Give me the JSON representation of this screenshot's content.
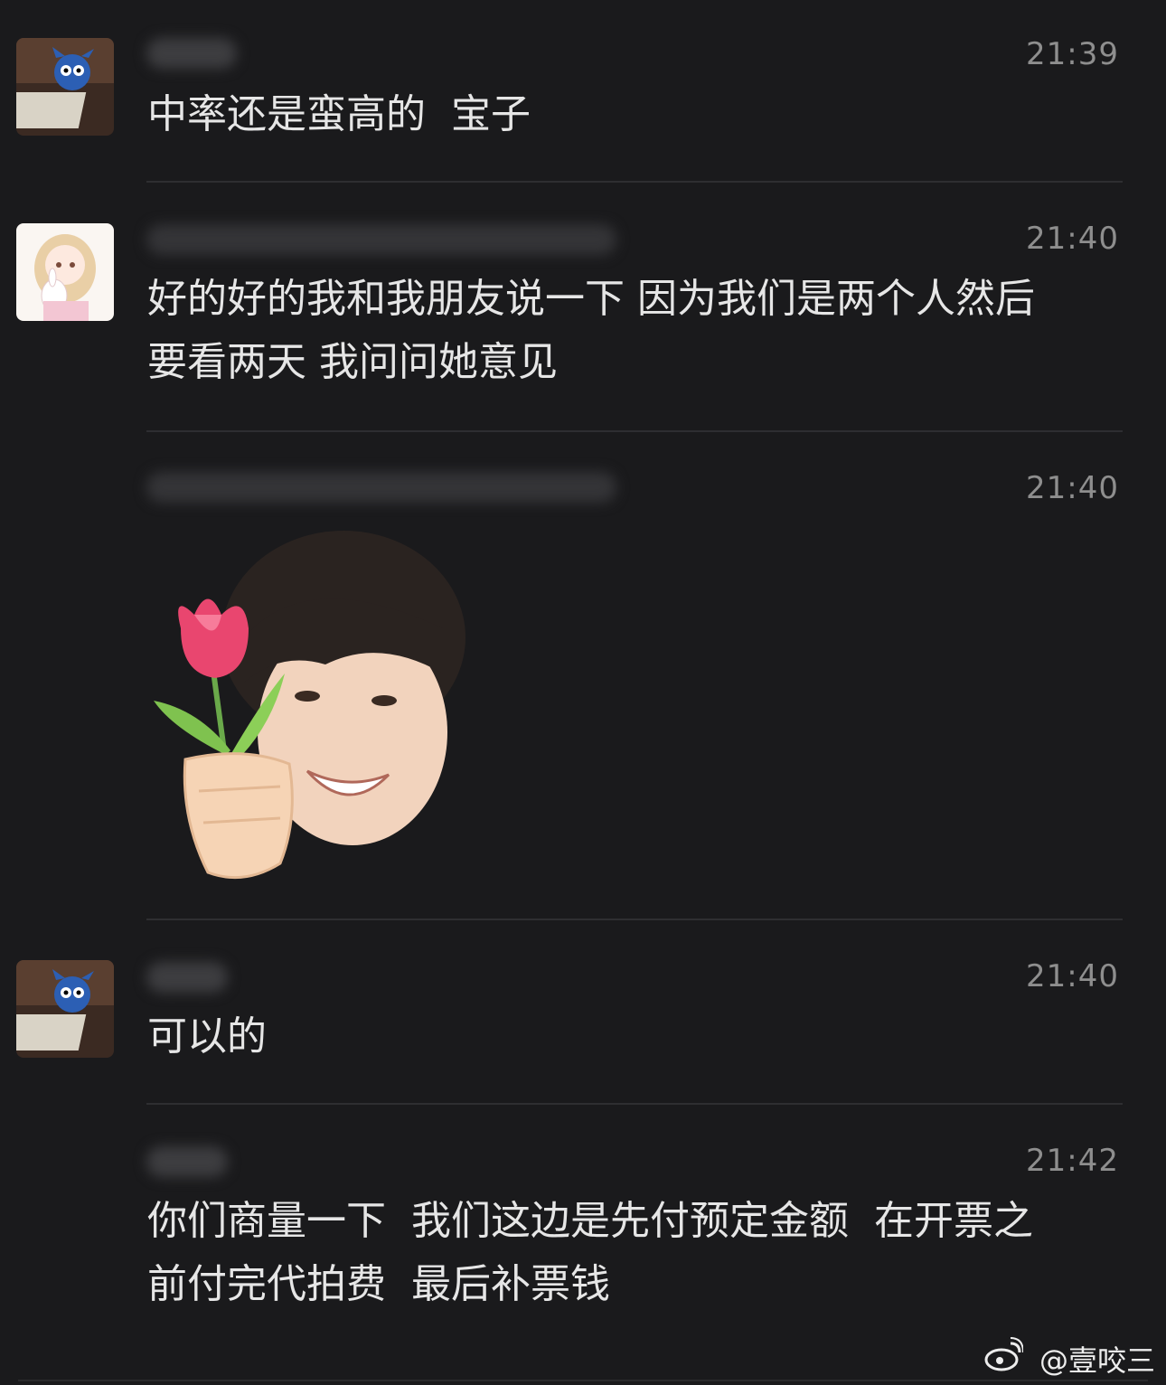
{
  "messages": [
    {
      "time": "21:39",
      "text": "中率还是蛮高的  宝子"
    },
    {
      "time": "21:40",
      "text": "好的好的我和我朋友说一下 因为我们是两个人然后\n要看两天 我问问她意见"
    },
    {
      "time": "21:40",
      "text": ""
    },
    {
      "time": "21:40",
      "text": "可以的"
    },
    {
      "time": "21:42",
      "text": "你们商量一下  我们这边是先付预定金额  在开票之\n前付完代拍费  最后补票钱"
    }
  ],
  "watermark": "@壹咬三",
  "sticker_icon": "tulip-boy-sticker",
  "colors": {
    "background": "#1a1a1c",
    "text": "#e6e6e6",
    "time": "#8e8e8e",
    "divider": "#2e2e31"
  }
}
